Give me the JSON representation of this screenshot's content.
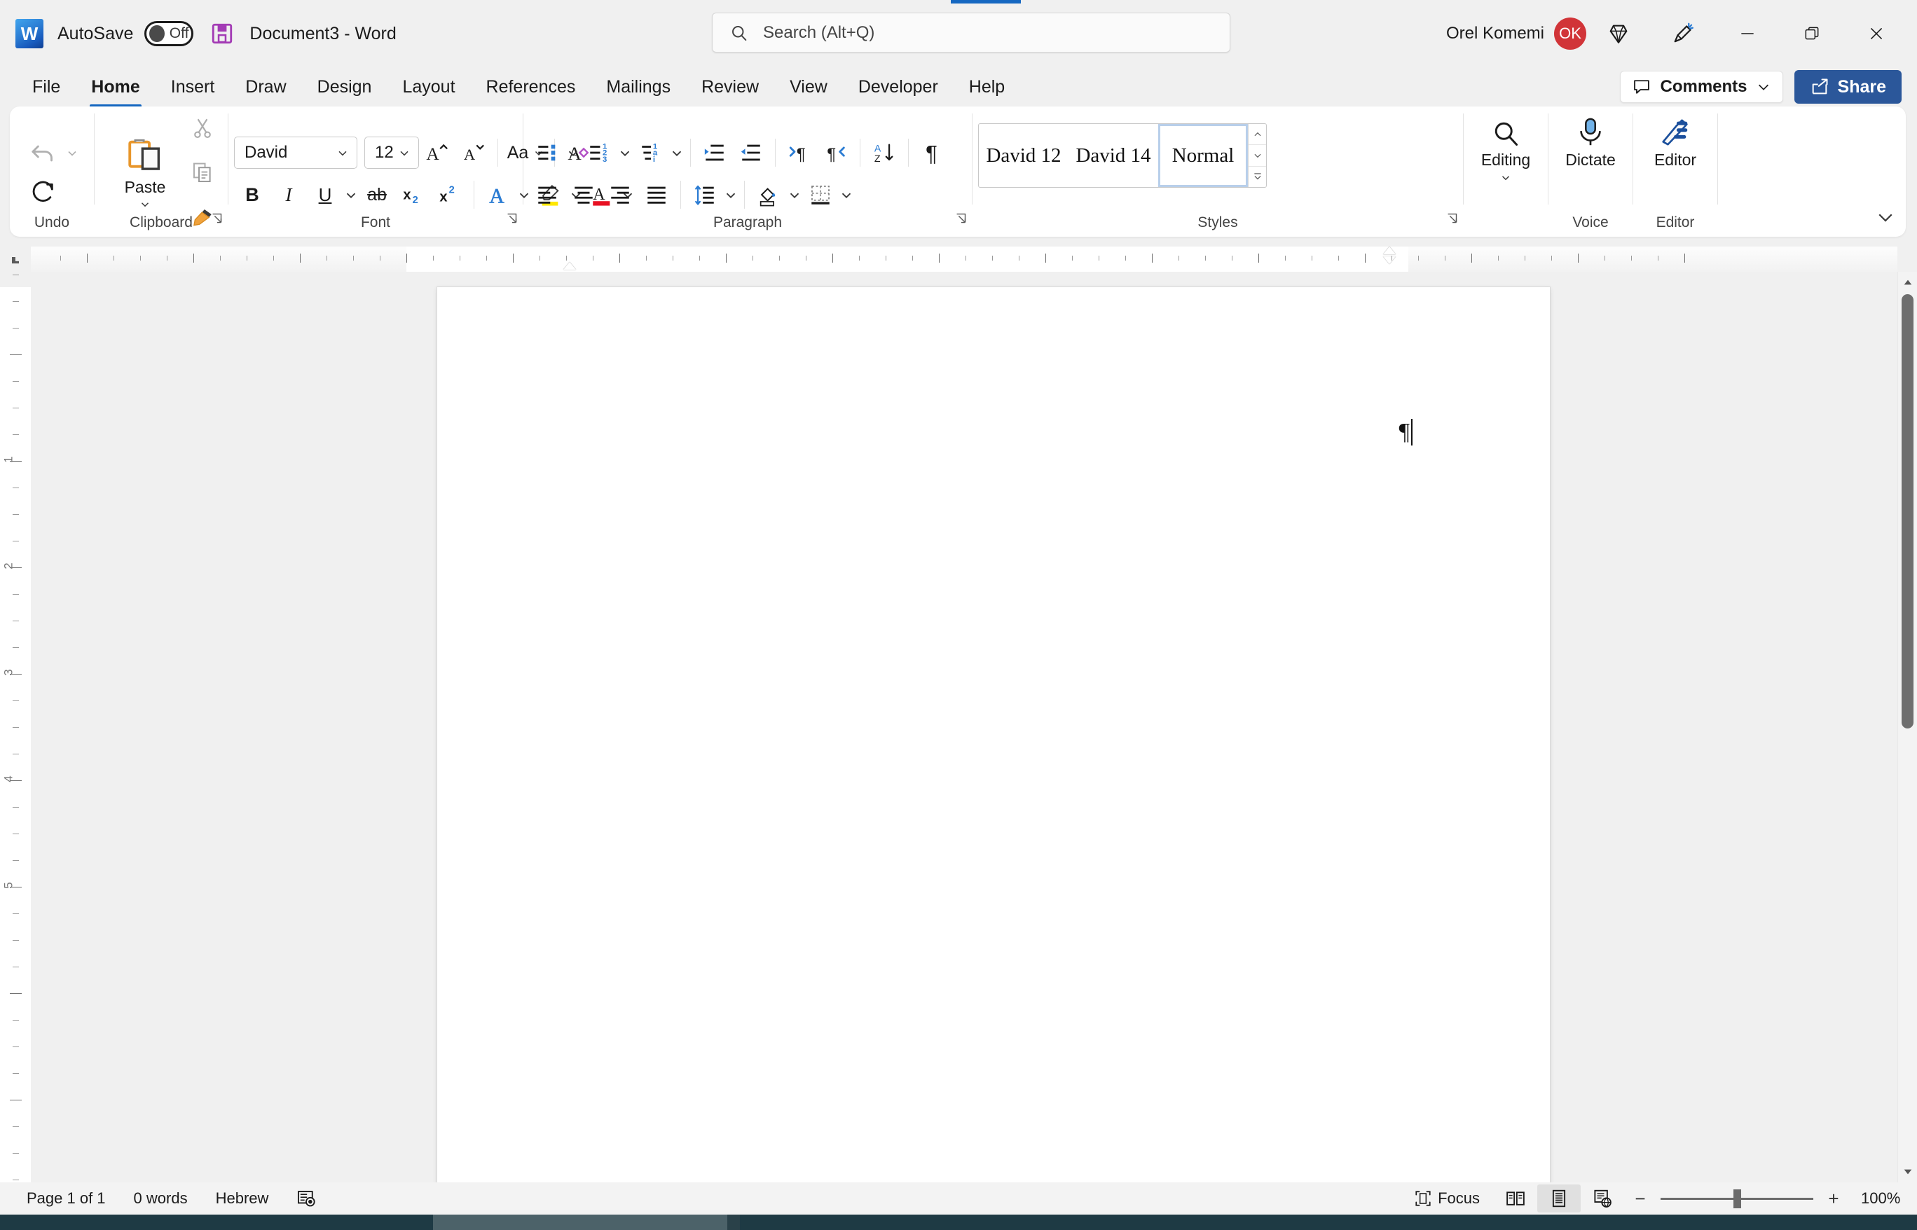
{
  "titlebar": {
    "logo_text": "W",
    "autosave_label": "AutoSave",
    "autosave_state": "Off",
    "save_icon": "save-icon",
    "document_title": "Document3  -  Word",
    "user_name": "Orel Komemi",
    "avatar_initials": "OK",
    "diamond_icon": "diamond-icon",
    "pen_icon": "pen-highlight-icon",
    "minimize_icon": "minimize-icon",
    "restore_icon": "restore-icon",
    "close_icon": "close-icon"
  },
  "search": {
    "placeholder": "Search (Alt+Q)",
    "icon": "search-icon"
  },
  "tabs": [
    {
      "label": "File",
      "active": false
    },
    {
      "label": "Home",
      "active": true
    },
    {
      "label": "Insert",
      "active": false
    },
    {
      "label": "Draw",
      "active": false
    },
    {
      "label": "Design",
      "active": false
    },
    {
      "label": "Layout",
      "active": false
    },
    {
      "label": "References",
      "active": false
    },
    {
      "label": "Mailings",
      "active": false
    },
    {
      "label": "Review",
      "active": false
    },
    {
      "label": "View",
      "active": false
    },
    {
      "label": "Developer",
      "active": false
    },
    {
      "label": "Help",
      "active": false
    }
  ],
  "tabs_right": {
    "comments_label": "Comments",
    "comments_icon": "comment-icon",
    "share_label": "Share",
    "share_icon": "share-icon"
  },
  "ribbon": {
    "undo": {
      "group_label": "Undo",
      "undo_icon": "undo-arrow-icon",
      "undo_dropdown_icon": "chevron-down-icon",
      "redo_icon": "redo-arrow-icon"
    },
    "clipboard": {
      "group_label": "Clipboard",
      "paste_label": "Paste",
      "paste_icon": "clipboard-paste-icon",
      "paste_dropdown_icon": "chevron-down-icon",
      "cut_icon": "scissors-icon",
      "copy_icon": "copy-icon",
      "format_painter_icon": "format-painter-icon",
      "dialog_launcher_icon": "dialog-launcher-icon"
    },
    "font": {
      "group_label": "Font",
      "font_name": "David",
      "font_size": "12",
      "grow_font_icon": "grow-font-icon",
      "shrink_font_icon": "shrink-font-icon",
      "change_case_label": "Aa",
      "change_case_icon": "change-case-icon",
      "clear_formatting_icon": "clear-formatting-icon",
      "bold_label": "B",
      "italic_label": "I",
      "underline_label": "U",
      "strikethrough_label": "ab",
      "subscript_label": "x",
      "superscript_label": "x",
      "text_effects_icon": "text-effects-icon",
      "highlight_icon": "text-highlight-icon",
      "font_color_icon": "font-color-icon",
      "dialog_launcher_icon": "dialog-launcher-icon"
    },
    "paragraph": {
      "group_label": "Paragraph",
      "bullets_icon": "bullet-list-icon",
      "numbering_icon": "numbered-list-icon",
      "multilevel_icon": "multilevel-list-icon",
      "increase_indent_icon": "increase-indent-icon",
      "decrease_indent_icon": "decrease-indent-icon",
      "ltr_icon": "left-to-right-icon",
      "rtl_icon": "right-to-left-icon",
      "sort_icon": "sort-az-icon",
      "show_marks_icon": "show-paragraph-marks-icon",
      "align_left_icon": "align-left-icon",
      "align_center_icon": "align-center-icon",
      "align_right_icon": "align-right-icon",
      "justify_icon": "justify-icon",
      "line_spacing_icon": "line-spacing-icon",
      "shading_icon": "shading-icon",
      "borders_icon": "borders-icon",
      "dialog_launcher_icon": "dialog-launcher-icon"
    },
    "styles": {
      "group_label": "Styles",
      "items": [
        {
          "label": "David 12",
          "selected": false
        },
        {
          "label": "David 14",
          "selected": false
        },
        {
          "label": "Normal",
          "selected": true
        }
      ],
      "scroll_up_icon": "chevron-up-icon",
      "scroll_down_icon": "chevron-down-icon",
      "more_icon": "styles-more-icon",
      "dialog_launcher_icon": "dialog-launcher-icon"
    },
    "editing": {
      "label": "Editing",
      "icon": "search-icon",
      "dropdown_icon": "chevron-down-icon"
    },
    "voice": {
      "group_label": "Voice",
      "dictate_label": "Dictate",
      "dictate_icon": "microphone-icon"
    },
    "editor": {
      "group_label": "Editor",
      "editor_label": "Editor",
      "editor_icon": "editor-pen-icon"
    },
    "collapse_icon": "chevron-down-icon"
  },
  "ruler": {
    "vertical_numbers": [
      "1",
      "2",
      "3",
      "4",
      "5"
    ],
    "first_line_indent_icon": "first-line-indent-marker",
    "hanging_indent_icon": "hanging-indent-marker",
    "right_indent_icon": "right-indent-marker",
    "tab_stop_icon": "left-tab-stop-icon"
  },
  "document": {
    "paragraph_mark": "¶",
    "cursor": "text-cursor"
  },
  "scrollbar": {
    "up_arrow_icon": "scroll-up-arrow",
    "down_arrow_icon": "scroll-down-arrow"
  },
  "statusbar": {
    "page_info": "Page 1 of 1",
    "word_count": "0 words",
    "language": "Hebrew",
    "proofing_icon": "proofing-status-icon",
    "focus_label": "Focus",
    "focus_icon": "focus-mode-icon",
    "read_mode_icon": "read-mode-icon",
    "print_layout_icon": "print-layout-icon",
    "web_layout_icon": "web-layout-icon",
    "zoom_out_label": "−",
    "zoom_in_label": "+",
    "zoom_level": "100%"
  },
  "colors": {
    "accent": "#1567c1",
    "share": "#2b579a",
    "avatar": "#d13438",
    "taskbar": "#1e3a44",
    "ribbon_bg": "#ffffff",
    "app_bg": "#f0f0f0"
  }
}
